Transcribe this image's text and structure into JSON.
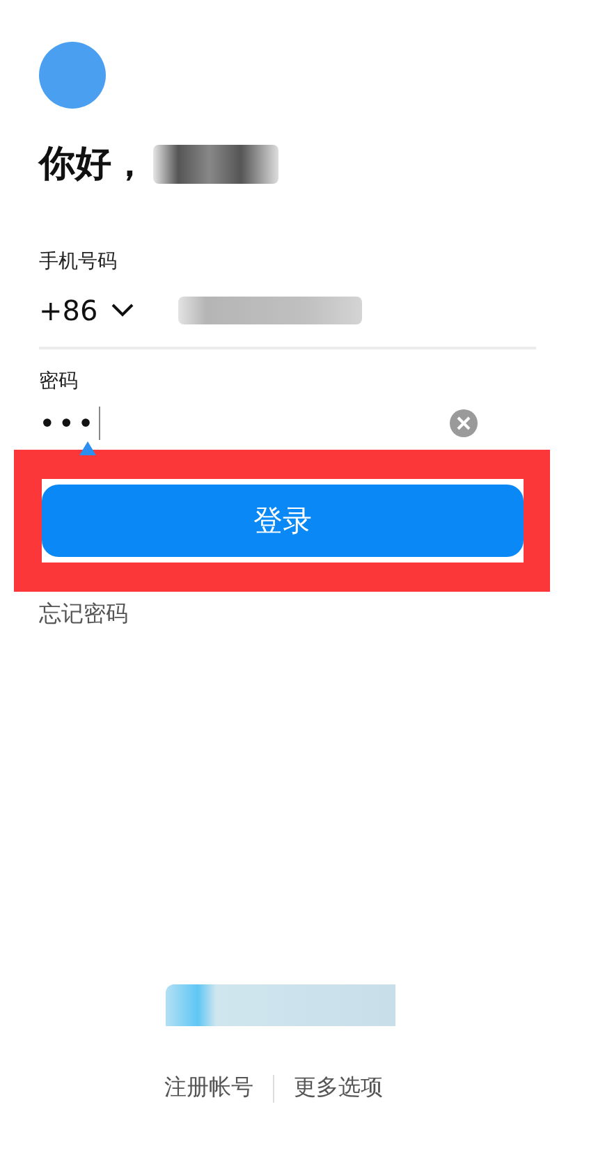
{
  "greeting": "你好，",
  "phone": {
    "label": "手机号码",
    "country_code": "+86"
  },
  "password": {
    "label": "密码",
    "value": "•••"
  },
  "login_button": {
    "label": "登录",
    "highlighted": true
  },
  "forgot_password": "忘记密码",
  "footer_links": [
    "注册帐号",
    "更多选项"
  ]
}
